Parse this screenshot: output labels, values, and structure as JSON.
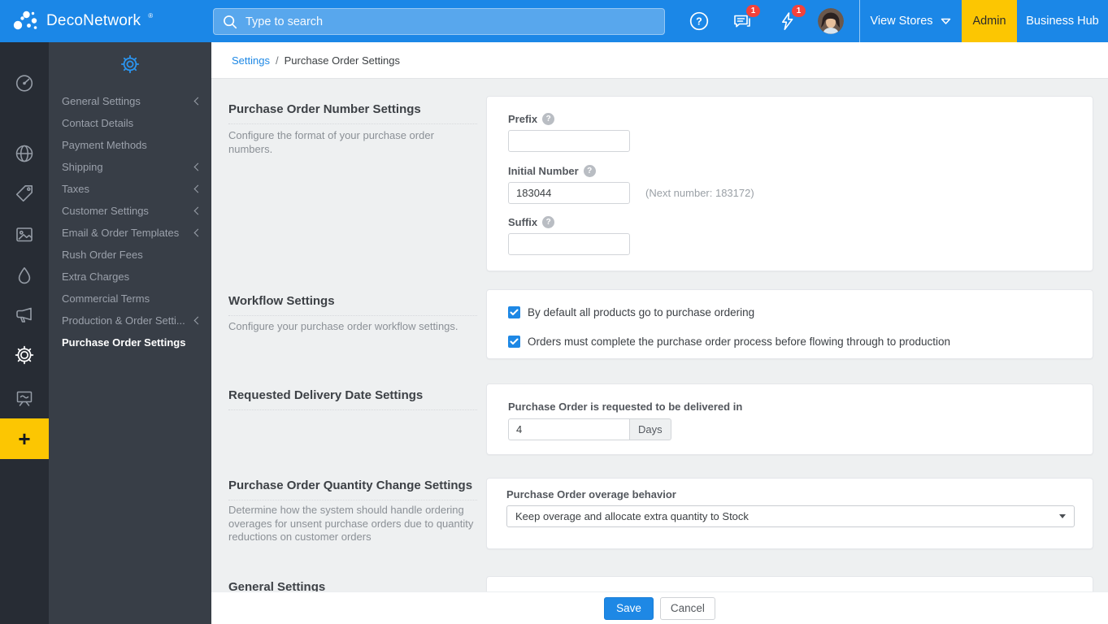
{
  "glyphs": {
    "question": "?"
  },
  "header": {
    "brand": "DecoNetwork",
    "registered": "®",
    "search_placeholder": "Type to search",
    "messages_badge": "1",
    "alerts_badge": "1",
    "view_stores_label": "View Stores",
    "admin_label": "Admin",
    "business_hub_label": "Business Hub"
  },
  "rail": {
    "icons": [
      "speedometer",
      "globe",
      "tag",
      "image",
      "droplet",
      "megaphone",
      "gear",
      "presentation",
      "person"
    ],
    "add_label": "+"
  },
  "sidebar": {
    "items": [
      {
        "label": "General Settings",
        "expandable": true,
        "active": false
      },
      {
        "label": "Contact Details",
        "expandable": false,
        "active": false
      },
      {
        "label": "Payment Methods",
        "expandable": false,
        "active": false
      },
      {
        "label": "Shipping",
        "expandable": true,
        "active": false
      },
      {
        "label": "Taxes",
        "expandable": true,
        "active": false
      },
      {
        "label": "Customer Settings",
        "expandable": true,
        "active": false
      },
      {
        "label": "Email & Order Templates",
        "expandable": true,
        "active": false
      },
      {
        "label": "Rush Order Fees",
        "expandable": false,
        "active": false
      },
      {
        "label": "Extra Charges",
        "expandable": false,
        "active": false
      },
      {
        "label": "Commercial Terms",
        "expandable": false,
        "active": false
      },
      {
        "label": "Production & Order Setti...",
        "expandable": true,
        "active": false
      },
      {
        "label": "Purchase Order Settings",
        "expandable": false,
        "active": true
      }
    ]
  },
  "breadcrumb": {
    "parent": "Settings",
    "separator": "/",
    "current": "Purchase Order Settings"
  },
  "sections": {
    "po_number": {
      "title": "Purchase Order Number Settings",
      "description": "Configure the format of your purchase order numbers.",
      "prefix_label": "Prefix",
      "prefix_value": "",
      "initial_label": "Initial Number",
      "initial_value": "183044",
      "next_number_note": "(Next number: 183172)",
      "suffix_label": "Suffix",
      "suffix_value": ""
    },
    "workflow": {
      "title": "Workflow Settings",
      "description": "Configure your purchase order workflow settings.",
      "checkboxes": [
        {
          "label": "By default all products go to purchase ordering",
          "checked": true
        },
        {
          "label": "Orders must complete the purchase order process before flowing through to production",
          "checked": true
        }
      ]
    },
    "delivery": {
      "title": "Requested Delivery Date Settings",
      "field_label": "Purchase Order is requested to be delivered in",
      "value": "4",
      "unit": "Days"
    },
    "quantity": {
      "title": "Purchase Order Quantity Change Settings",
      "description": "Determine how the system should handle ordering overages for unsent purchase orders due to quantity reductions on customer orders",
      "field_label": "Purchase Order overage behavior",
      "selected": "Keep overage and allocate extra quantity to Stock"
    },
    "general": {
      "title": "General Settings"
    }
  },
  "footer": {
    "save_label": "Save",
    "cancel_label": "Cancel"
  },
  "colors": {
    "header_blue": "#1b87e7",
    "accent_yellow": "#fcc602",
    "link_blue": "#1e88e5",
    "badge_red": "#f4423b",
    "rail_bg": "#272c34",
    "sidebar_bg": "#383e47",
    "content_bg": "#eef0f1",
    "checkbox_blue": "#1e88e5"
  }
}
